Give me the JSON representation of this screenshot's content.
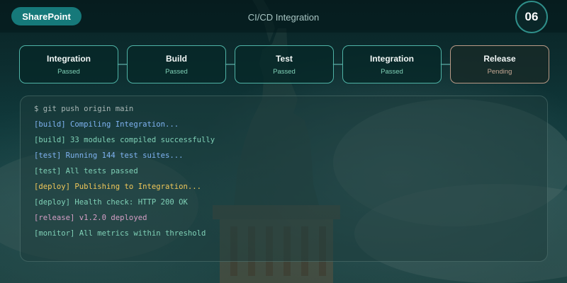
{
  "header": {
    "brand": "SharePoint",
    "title": "CI/CD Integration",
    "slide_number": "06"
  },
  "pipeline": {
    "stages": [
      {
        "name": "Integration",
        "status": "Passed"
      },
      {
        "name": "Build",
        "status": "Passed"
      },
      {
        "name": "Test",
        "status": "Passed"
      },
      {
        "name": "Integration",
        "status": "Passed"
      },
      {
        "name": "Release",
        "status": "Pending"
      }
    ]
  },
  "terminal": {
    "lines": [
      {
        "text": "$ git push origin main",
        "color": "#a8b6b5"
      },
      {
        "text": "[build] Compiling Integration...",
        "color": "#7fb3f2"
      },
      {
        "text": "[build] 33 modules compiled successfully",
        "color": "#7fd0b6"
      },
      {
        "text": "[test] Running 144 test suites...",
        "color": "#7fb3f2"
      },
      {
        "text": "[test] All tests passed",
        "color": "#7fd0b6"
      },
      {
        "text": "[deploy] Publishing to Integration...",
        "color": "#f0c85a"
      },
      {
        "text": "[deploy] Health check: HTTP 200 OK",
        "color": "#7fd0b6"
      },
      {
        "text": "[release] v1.2.0 deployed",
        "color": "#d59fc6"
      },
      {
        "text": "[monitor] All metrics within threshold",
        "color": "#7fd0b6"
      }
    ]
  },
  "theme": {
    "accent": "#16797a",
    "passed": "#7fd0b6",
    "pending": "#c6a894"
  }
}
